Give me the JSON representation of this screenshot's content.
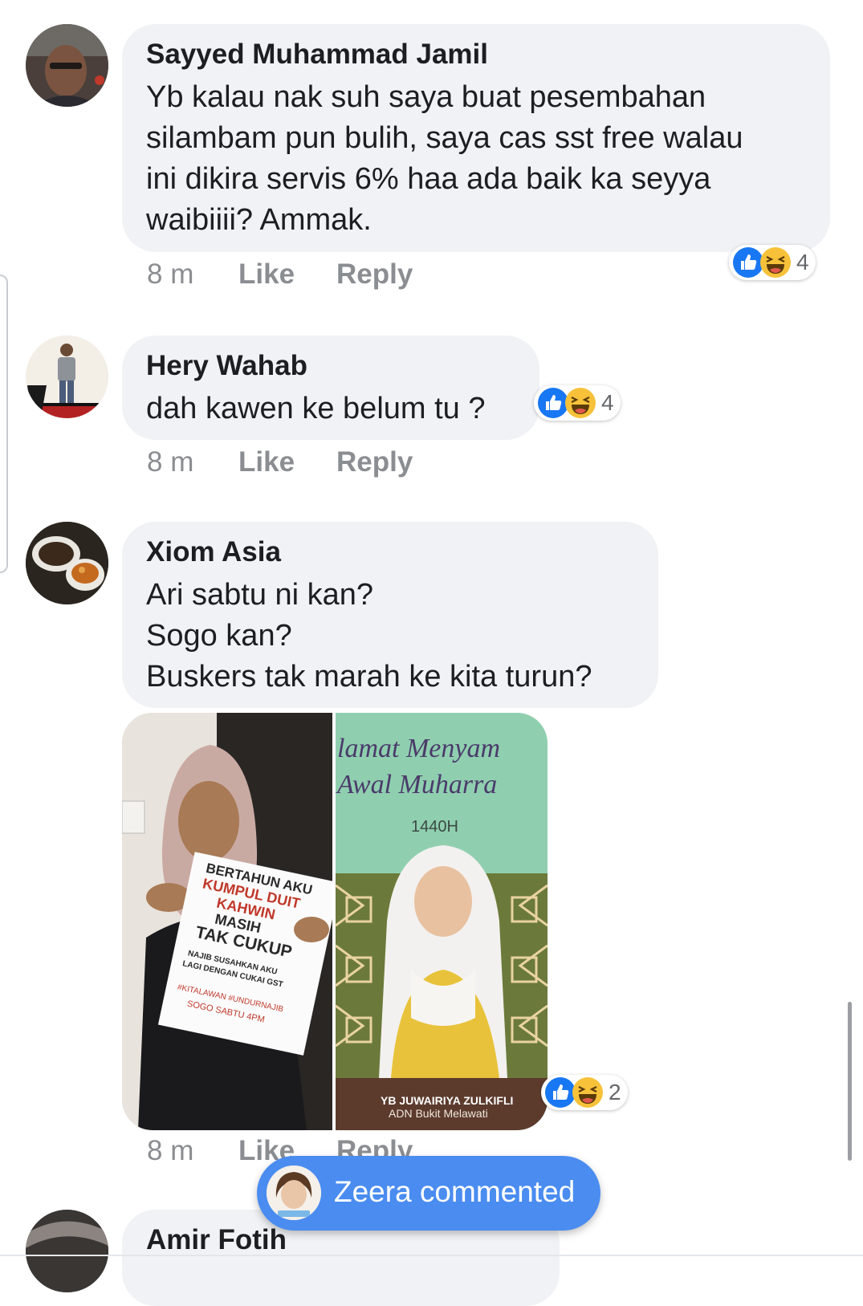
{
  "comments": [
    {
      "author": "Sayyed Muhammad Jamil",
      "text": "Yb kalau nak suh saya buat pesembahan\nsilambam pun bulih, saya cas sst free walau\nini dikira servis 6% haa ada baik ka seyya\nwaibiiii? Ammak.",
      "time": "8 m",
      "like": "Like",
      "reply": "Reply",
      "reaction_count": "4"
    },
    {
      "author": "Hery Wahab",
      "text": "dah kawen ke belum tu ?",
      "time": "8 m",
      "like": "Like",
      "reply": "Reply",
      "reaction_count": "4"
    },
    {
      "author": "Xiom Asia",
      "text": "Ari sabtu ni kan?\nSogo kan?\nBuskers tak marah ke kita turun?",
      "time": "8 m",
      "like": "Like",
      "reply": "Reply",
      "reaction_count": "2",
      "photo": {
        "left_sign": [
          "BERTAHUN AKU",
          "KUMPUL DUIT",
          "KAHWIN",
          "MASIH",
          "TAK CUKUP",
          "NAJIB SUSAHKAN AKU",
          "LAGI DENGAN CUKAI GST",
          "#KITALAWAN #UNDURNAJIB",
          "SOGO SABTU 4PM"
        ],
        "right_line1": "lamat Menyam",
        "right_line2": "Awal Muharra",
        "right_year": "1440H",
        "right_name": "YB JUWAIRIYA ZULKIFLI",
        "right_sub": "ADN Bukit Melawati"
      }
    },
    {
      "author": "Amir Fotih"
    }
  ],
  "toast": {
    "label": "Zeera commented"
  },
  "colors": {
    "bubble": "#f0f2f5",
    "meta": "#8a8d91",
    "like_blue": "#1877f2",
    "haha_yellow": "#f7c23a",
    "toast": "#4a8cf0"
  }
}
